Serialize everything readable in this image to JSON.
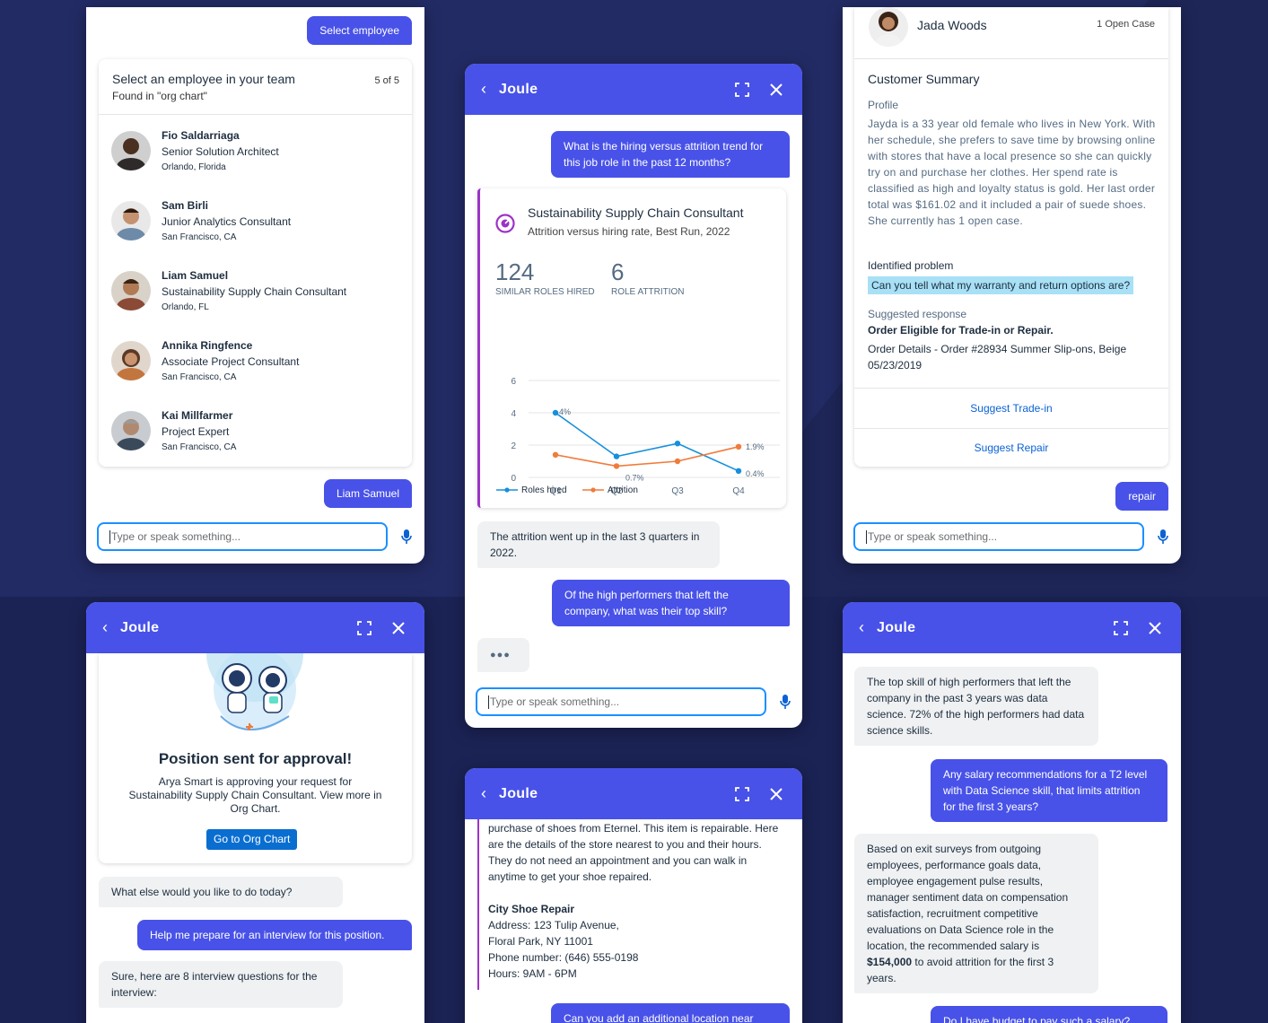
{
  "colors": {
    "accent": "#4852e8",
    "focus": "#1b90ff",
    "attrition": "#f07b3c",
    "hired": "#168fdc",
    "chart_icon": "#9b33c8"
  },
  "input_placeholder": "Type or speak something...",
  "p1": {
    "top_user_msg": "Select employee",
    "card_title": "Select an employee in your team",
    "card_sub": "Found in \"org chart\"",
    "card_count": "5 of 5",
    "employees": [
      {
        "name": "Fio Saldarriaga",
        "role": "Senior Solution Architect",
        "loc": "Orlando, Florida"
      },
      {
        "name": "Sam Birli",
        "role": "Junior Analytics Consultant",
        "loc": "San Francisco, CA"
      },
      {
        "name": "Liam Samuel",
        "role": "Sustainability Supply Chain Consultant",
        "loc": "Orlando, FL"
      },
      {
        "name": "Annika Ringfence",
        "role": "Associate Project Consultant",
        "loc": "San Francisco, CA"
      },
      {
        "name": "Kai Millfarmer",
        "role": "Project Expert",
        "loc": "San Francisco, CA"
      }
    ],
    "selected_msg": "Liam Samuel"
  },
  "p2": {
    "header_title": "Joule",
    "user_q1": "What is the hiring versus attrition trend for this job role in the past 12 months?",
    "chart_title": "Sustainability Supply Chain Consultant",
    "chart_sub": "Attrition versus hiring rate, Best Run, 2022",
    "kpi1_value": "124",
    "kpi1_label": "SIMILAR ROLES HIRED",
    "kpi2_value": "6",
    "kpi2_label": "ROLE ATTRITION",
    "bot_a1": "The attrition went up in the last 3 quarters in 2022.",
    "user_q2": "Of the high performers that left the company, what was their top skill?",
    "typing": "●●●"
  },
  "chart_data": {
    "type": "line",
    "categories": [
      "Q1",
      "Q2",
      "Q3",
      "Q4"
    ],
    "ylim": [
      0,
      6
    ],
    "yticks": [
      "0",
      "2",
      "4",
      "6"
    ],
    "series": [
      {
        "name": "Roles hired",
        "values": [
          4,
          1.3,
          2.1,
          0.4
        ],
        "color": "#168fdc"
      },
      {
        "name": "Attrition",
        "values": [
          1.4,
          0.7,
          1.0,
          1.9
        ],
        "color": "#f07b3c"
      }
    ],
    "data_labels": [
      "4%",
      "0.7%",
      "1.9%",
      "0.4%"
    ],
    "legend": "bottom-left"
  },
  "p3": {
    "customer_name": "Jada Woods",
    "open_cases": "1 Open Case",
    "summary_title": "Customer Summary",
    "profile_label": "Profile",
    "profile_text": "Jayda is a 33 year old female who lives in New York. With her schedule, she prefers to save time by browsing online with stores that have a local presence so she can quickly try on and purchase her clothes. Her spend rate is classified as high and loyalty status is gold. Her last order total was $161.02 and it included a pair of suede shoes. She currently has 1 open case.",
    "problem_label": "Identified problem",
    "problem_text": "Can you tell what my warranty and return options are?",
    "response_label": "Suggested response",
    "response_bold": "Order Eligible for Trade-in or Repair.",
    "response_details": "Order Details - Order #28934 Summer Slip-ons, Beige 05/23/2019",
    "action1": "Suggest Trade-in",
    "action2": "Suggest Repair",
    "user_msg": "repair"
  },
  "p4": {
    "header_title": "Joule",
    "approval_title": "Position sent for approval!",
    "approval_text": "Arya Smart is approving your request for Sustainability Supply Chain Consultant. View more in Org Chart.",
    "approval_button": "Go to Org Chart",
    "bot1": "What else would you like to do today?",
    "user1": "Help me prepare for an interview for this position.",
    "bot2": "Sure, here are 8 interview questions for the interview:"
  },
  "p5": {
    "header_title": "Joule",
    "text_top": "purchase of shoes from Eternel. This item is repairable. Here are the details of the store nearest to you and their hours. They do not need an appointment and you can walk in anytime to get your shoe repaired.",
    "store_name": "City Shoe Repair",
    "store_address": "Address: 123 Tulip Avenue,",
    "store_city": "Floral Park, NY 11001",
    "store_phone": "Phone number: (646) 555-0198",
    "store_hours": "Hours: 9AM - 6PM",
    "user_msg": "Can you add an additional location near"
  },
  "p6": {
    "header_title": "Joule",
    "bot1": "The top skill of high performers that left the company in the past 3 years was data science. 72% of the high performers had data science skills.",
    "user1": "Any salary recommendations for a T2 level with Data Science skill, that limits attrition for the first 3 years?",
    "bot2_before": "Based on exit surveys from outgoing employees, performance goals data, employee engagement pulse results, manager sentiment data on compensation satisfaction, recruitment competitive evaluations on Data Science role in the location, the recommended salary is",
    "bot2_bold": "$154,000",
    "bot2_after": " to avoid attrition for the first 3 years.",
    "user2": "Do I have budget to pay such a salary?"
  }
}
